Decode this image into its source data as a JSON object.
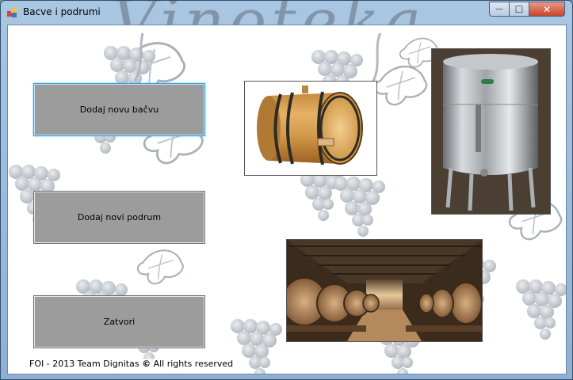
{
  "window": {
    "title": "Bacve i podrumi",
    "watermark": "Vinoteka",
    "controls": {
      "minimize": "—",
      "maximize": "☐",
      "close": "✕"
    }
  },
  "buttons": {
    "add_barrel": "Dodaj novu bačvu",
    "add_cellar": "Dodaj novi podrum",
    "close": "Zatvori"
  },
  "footer": {
    "text_before": "FOI - 2013 Team Dignitas",
    "symbol": "©",
    "text_after": "All rights reserved"
  },
  "colors": {
    "button_face": "#9c9c9c",
    "focus_border": "#3a9fe0",
    "grape_art": "#9aa3ac"
  }
}
